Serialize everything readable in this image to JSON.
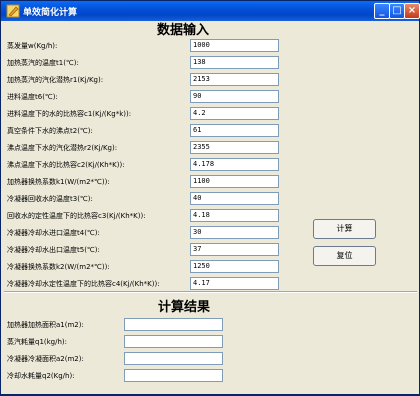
{
  "window": {
    "title": "单效简化计算"
  },
  "input_section": {
    "heading": "数据输入",
    "fields": [
      {
        "label": "蒸发量w(Kg/h):",
        "value": "1000"
      },
      {
        "label": "加热蒸汽的温度t1(℃):",
        "value": "138"
      },
      {
        "label": "加热蒸汽的汽化潜热r1(Kj/Kg):",
        "value": "2153"
      },
      {
        "label": "进料温度t6(℃):",
        "value": "90"
      },
      {
        "label": "进料温度下的水的比热容c1(Kj/(Kg*k)):",
        "value": "4.2"
      },
      {
        "label": "真空条件下水的沸点t2(℃):",
        "value": "61"
      },
      {
        "label": "沸点温度下水的汽化潜热r2(Kj/Kg):",
        "value": "2355"
      },
      {
        "label": "沸点温度下水的比热容c2(Kj/(Kh*K)):",
        "value": "4.178"
      },
      {
        "label": "加热器换热系数k1(W/(m2*℃)):",
        "value": "1100"
      },
      {
        "label": "冷凝器回收水的温度t3(℃):",
        "value": "40"
      },
      {
        "label": "回收水的定性温度下的比热容c3(Kj/(Kh*K)):",
        "value": "4.18"
      },
      {
        "label": "冷凝器冷却水进口温度t4(℃):",
        "value": "30"
      },
      {
        "label": "冷凝器冷却水出口温度t5(℃):",
        "value": "37"
      },
      {
        "label": "冷凝器换热系数k2(W/(m2*℃)):",
        "value": "1250"
      },
      {
        "label": "冷凝器冷却水定性温度下的比热容c4(Kj/(Kh*K)):",
        "value": "4.17"
      }
    ]
  },
  "buttons": {
    "calculate": "计算",
    "reset": "复位"
  },
  "result_section": {
    "heading": "计算结果",
    "fields": [
      {
        "label": "加热器加热面积a1(m2):",
        "value": ""
      },
      {
        "label": "蒸汽耗量q1(kg/h):",
        "value": ""
      },
      {
        "label": "冷凝器冷凝面积a2(m2):",
        "value": ""
      },
      {
        "label": "冷却水耗量q2(Kg/h):",
        "value": ""
      }
    ]
  },
  "colors": {
    "titlebar": "#0450d8",
    "face": "#ece9d8",
    "input_border": "#7f9db9"
  }
}
